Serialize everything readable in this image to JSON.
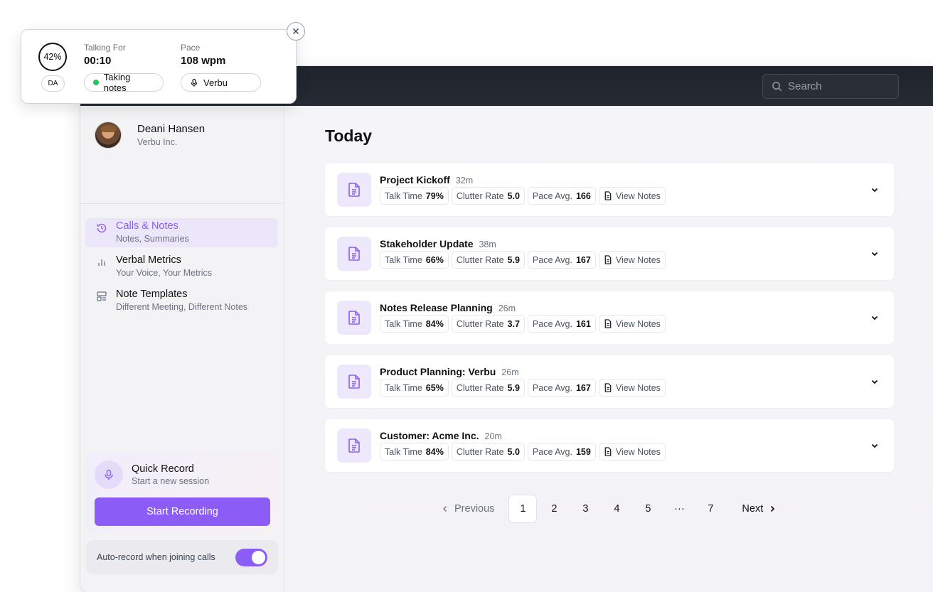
{
  "search": {
    "placeholder": "Search"
  },
  "profile": {
    "name": "Deani Hansen",
    "org": "Verbu Inc."
  },
  "nav": [
    {
      "title": "Calls & Notes",
      "sub": "Notes, Summaries",
      "icon": "history-icon",
      "active": true
    },
    {
      "title": "Verbal Metrics",
      "sub": "Your Voice, Your Metrics",
      "icon": "bar-chart-icon"
    },
    {
      "title": "Note Templates",
      "sub": "Different Meeting, Different Notes",
      "icon": "template-icon"
    }
  ],
  "quick_record": {
    "title": "Quick Record",
    "subtitle": "Start a new session",
    "button": "Start Recording"
  },
  "auto_record": {
    "label": "Auto-record when joining calls",
    "enabled": true
  },
  "main": {
    "title": "Today"
  },
  "labels": {
    "talk": "Talk Time",
    "clutter": "Clutter Rate",
    "pace": "Pace Avg.",
    "view": "View Notes"
  },
  "calls": [
    {
      "title": "Project Kickoff",
      "duration": "32m",
      "talk": "79%",
      "clutter": "5.0",
      "pace": "166"
    },
    {
      "title": "Stakeholder Update",
      "duration": "38m",
      "talk": "66%",
      "clutter": "5.9",
      "pace": "167"
    },
    {
      "title": "Notes Release Planning",
      "duration": "26m",
      "talk": "84%",
      "clutter": "3.7",
      "pace": "161"
    },
    {
      "title": "Product Planning: Verbu",
      "duration": "26m",
      "talk": "65%",
      "clutter": "5.9",
      "pace": "167"
    },
    {
      "title": "Customer: Acme Inc.",
      "duration": "20m",
      "talk": "84%",
      "clutter": "5.0",
      "pace": "159"
    }
  ],
  "pagination": {
    "prev": "Previous",
    "next": "Next",
    "pages": [
      "1",
      "2",
      "3",
      "4",
      "5",
      "···",
      "7"
    ],
    "current": "1"
  },
  "popup": {
    "percent": "42%",
    "initials": "DA",
    "talking_label": "Talking For",
    "talking_value": "00:10",
    "pace_label": "Pace",
    "pace_value": "108 wpm",
    "status": "Taking notes",
    "mic": "Verbu"
  },
  "colors": {
    "accent": "#8b5cf6",
    "status_green": "#22c55e",
    "topbar": "#23272f"
  }
}
